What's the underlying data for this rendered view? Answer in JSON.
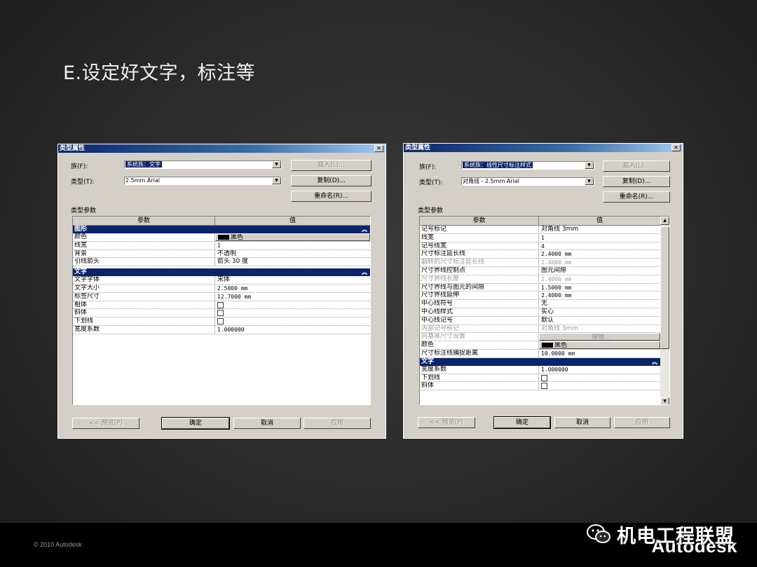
{
  "slide": {
    "title": "E.设定好文字，标注等",
    "copyright": "© 2010 Autodesk",
    "brand": "Autodesk",
    "watermark": "机电工程联盟"
  },
  "dialog_left": {
    "title": "类型属性",
    "family_label": "族(F):",
    "family_value": "系统族：文字",
    "type_label": "类型(T):",
    "type_value": "2.5mm Arial",
    "load_btn": "载入(L)...",
    "duplicate_btn": "复制(D)...",
    "rename_btn": "重命名(R)...",
    "params_label": "类型参数",
    "col_param": "参数",
    "col_value": "值",
    "groups": [
      {
        "name": "图形",
        "rows": [
          {
            "param": "颜色",
            "value": "黑色",
            "kind": "color"
          },
          {
            "param": "线宽",
            "value": "1"
          },
          {
            "param": "背景",
            "value": "不透明"
          },
          {
            "param": "引线箭头",
            "value": "箭头 30 度"
          }
        ]
      },
      {
        "name": "文字",
        "rows": [
          {
            "param": "文字字体",
            "value": "宋体"
          },
          {
            "param": "文字大小",
            "value": "2.5000 mm"
          },
          {
            "param": "标签尺寸",
            "value": "12.7000 mm"
          },
          {
            "param": "粗体",
            "value": "",
            "kind": "check"
          },
          {
            "param": "斜体",
            "value": "",
            "kind": "check"
          },
          {
            "param": "下划线",
            "value": "",
            "kind": "check"
          },
          {
            "param": "宽度系数",
            "value": "1.000000"
          }
        ]
      }
    ],
    "preview_btn": "<< 预览(P)",
    "ok_btn": "确定",
    "cancel_btn": "取消",
    "apply_btn": "应用"
  },
  "dialog_right": {
    "title": "类型属性",
    "family_label": "族(F):",
    "family_value": "系统族：线性尺寸标注样式",
    "type_label": "类型(T):",
    "type_value": "对角线 - 2.5mm Arial",
    "load_btn": "载入(L)...",
    "duplicate_btn": "复制(D)...",
    "rename_btn": "重命名(R)...",
    "params_label": "类型参数",
    "col_param": "参数",
    "col_value": "值",
    "rows": [
      {
        "param": "记号标记",
        "value": "对角线 3mm"
      },
      {
        "param": "线宽",
        "value": "1"
      },
      {
        "param": "记号线宽",
        "value": "4"
      },
      {
        "param": "尺寸标注延长线",
        "value": "2.4000 mm"
      },
      {
        "param": "翻转的尺寸标注延长线",
        "value": "2.4000 mm",
        "kind": "gray"
      },
      {
        "param": "尺寸界线控制点",
        "value": "图元间隙"
      },
      {
        "param": "尺寸界线长度",
        "value": "2.4000 mm",
        "kind": "gray"
      },
      {
        "param": "尺寸界线与图元的间隙",
        "value": "1.5000 mm"
      },
      {
        "param": "尺寸界线延伸",
        "value": "2.4000 mm"
      },
      {
        "param": "中心线符号",
        "value": "无"
      },
      {
        "param": "中心线样式",
        "value": "实心"
      },
      {
        "param": "中心线记号",
        "value": "默认"
      },
      {
        "param": "内部记号标记",
        "value": "对角线 3mm",
        "kind": "gray"
      },
      {
        "param": "同基准尺寸设置",
        "value": "编辑...",
        "kind": "edit"
      },
      {
        "param": "颜色",
        "value": "黑色",
        "kind": "color"
      },
      {
        "param": "尺寸标注线捕捉距离",
        "value": "10.0000 mm"
      }
    ],
    "text_group": {
      "name": "文字",
      "rows": [
        {
          "param": "宽度系数",
          "value": "1.000000"
        },
        {
          "param": "下划线",
          "value": "",
          "kind": "check"
        },
        {
          "param": "斜体",
          "value": "",
          "kind": "check"
        }
      ]
    },
    "preview_btn": "<< 预览(P)",
    "ok_btn": "确定",
    "cancel_btn": "取消",
    "apply_btn": "应用"
  }
}
